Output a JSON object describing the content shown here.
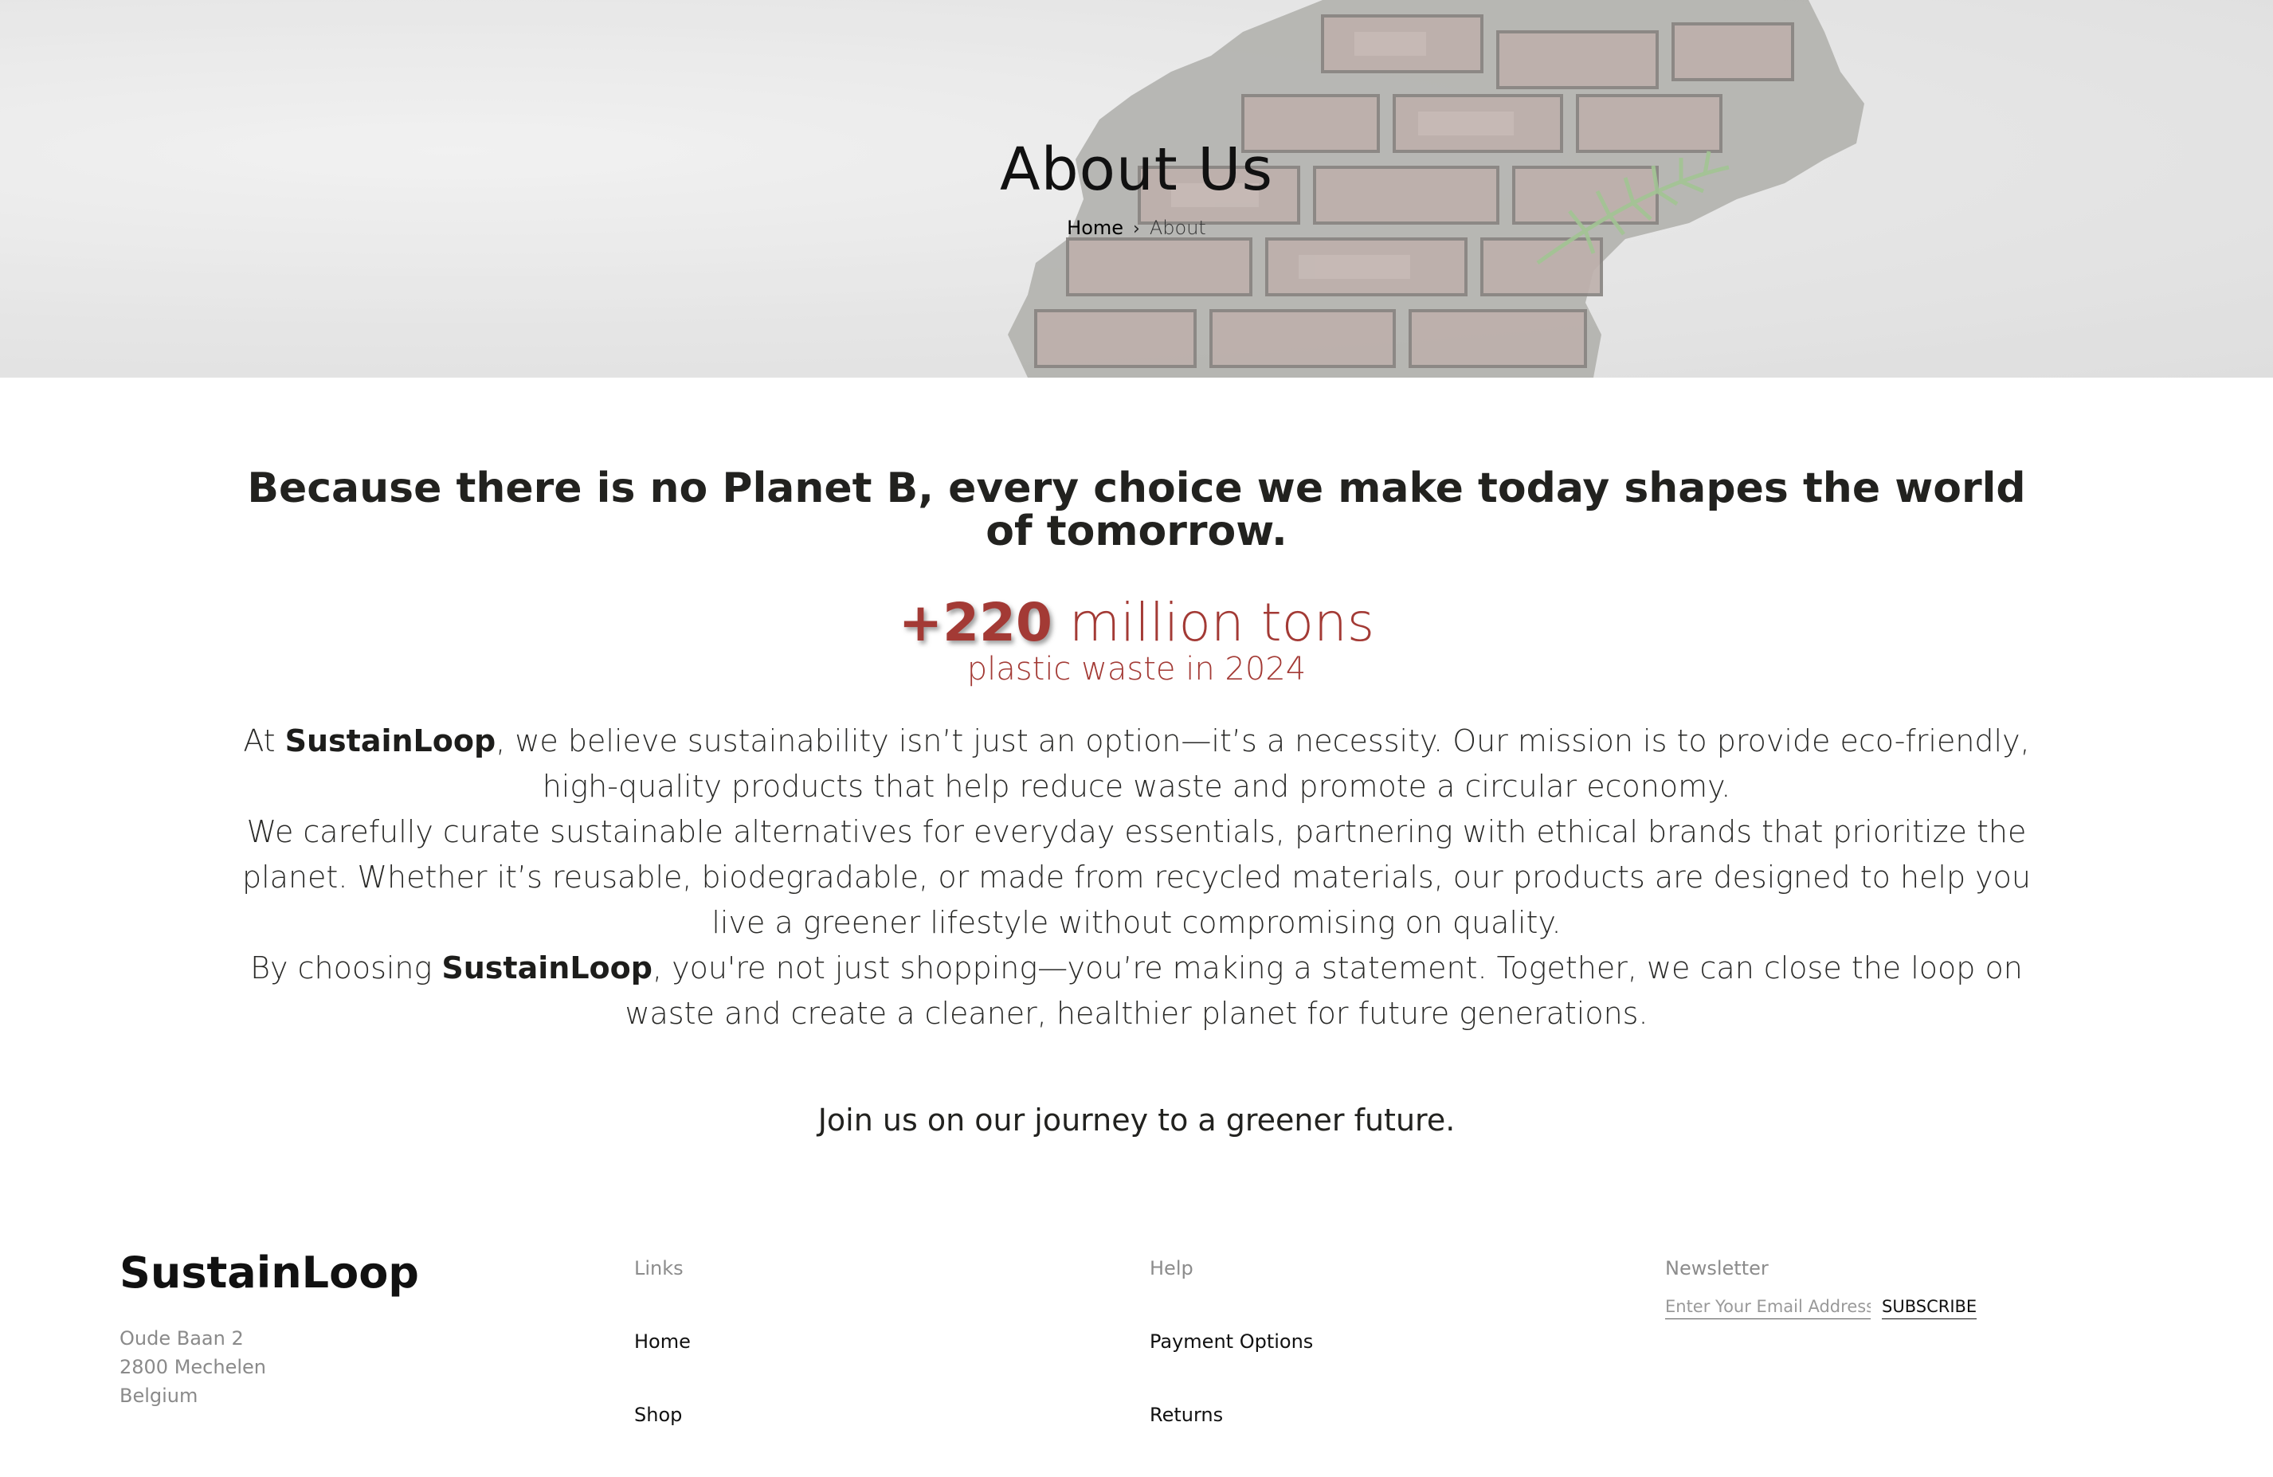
{
  "hero": {
    "title": "About Us",
    "breadcrumb": {
      "home": "Home",
      "separator": "›",
      "current": "About"
    }
  },
  "main": {
    "headline": "Because there is no Planet B, every choice we make today shapes the world of tomorrow.",
    "stat": {
      "number": "+220",
      "unit": "million tons",
      "caption": "plastic waste in 2024",
      "color": "#a33a35"
    },
    "paragraphs": [
      {
        "before": "At ",
        "brand": "SustainLoop",
        "after": ", we believe sustainability isn’t just an option—it’s a necessity. Our mission is to provide eco-friendly, high-quality products that help reduce waste and promote a circular economy."
      },
      {
        "text": "We carefully curate sustainable alternatives for everyday essentials, partnering with ethical brands that prioritize the planet. Whether it’s reusable, biodegradable, or made from recycled materials, our products are designed to help you live a greener lifestyle without compromising on quality."
      },
      {
        "before": "By choosing ",
        "brand": "SustainLoop",
        "after": ", you're not just shopping—you’re making a statement. Together, we can close the loop on waste and create a cleaner, healthier planet for future generations."
      }
    ],
    "cta": "Join us on our journey to a greener future."
  },
  "footer": {
    "brand": "SustainLoop",
    "address": [
      "Oude Baan 2",
      "2800 Mechelen",
      "Belgium"
    ],
    "links": {
      "title": "Links",
      "items": [
        "Home",
        "Shop"
      ]
    },
    "help": {
      "title": "Help",
      "items": [
        "Payment Options",
        "Returns"
      ]
    },
    "newsletter": {
      "title": "Newsletter",
      "placeholder": "Enter Your Email Address",
      "button": "SUBSCRIBE"
    }
  }
}
